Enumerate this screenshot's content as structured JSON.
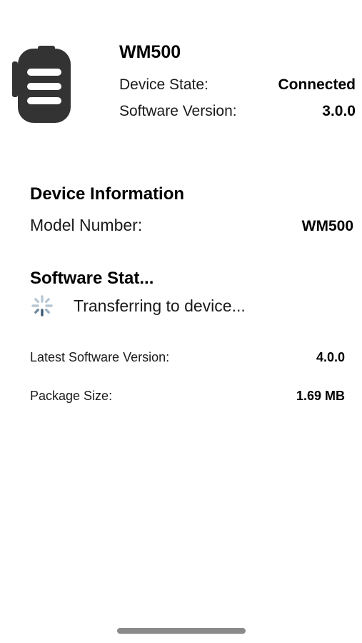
{
  "header": {
    "device_name": "WM500",
    "device_state_label": "Device State:",
    "device_state_value": "Connected",
    "software_version_label": "Software Version:",
    "software_version_value": "3.0.0"
  },
  "device_information": {
    "title": "Device Information",
    "model_number_label": "Model Number:",
    "model_number_value": "WM500"
  },
  "software_status": {
    "title": "Software Stat...",
    "transfer_text": "Transferring to device...",
    "latest_version_label": "Latest Software Version:",
    "latest_version_value": "4.0.0",
    "package_size_label": "Package Size:",
    "package_size_value": "1.69 MB"
  },
  "icons": {
    "device": "transmitter-device-icon",
    "spinner": "loading-spinner-icon"
  },
  "colors": {
    "device_icon": "#333333",
    "spinner_dark": "#3d5a73",
    "spinner_light": "#b8c7d4",
    "home_indicator": "#8a8a8a"
  }
}
